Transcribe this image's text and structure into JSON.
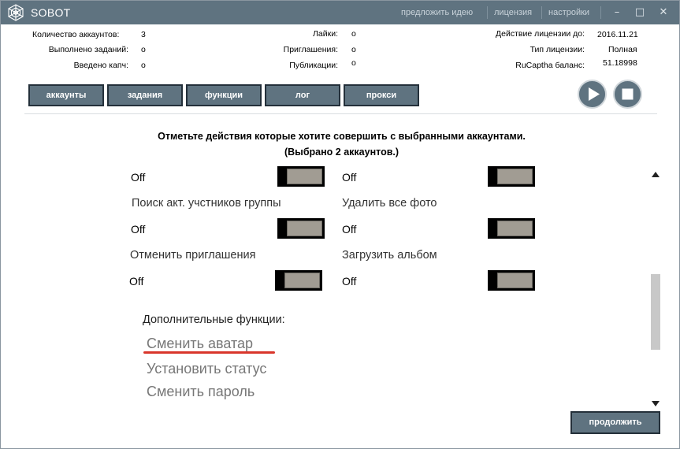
{
  "titlebar": {
    "app_title": "SOBOT",
    "links": [
      "предложить идею",
      "лицензия",
      "настройки"
    ],
    "minimize": "–",
    "maximize": "□",
    "close": "✕"
  },
  "stats": {
    "accounts_label": "Количество аккаунтов:",
    "accounts_value": "3",
    "tasks_done_label": "Выполнено заданий:",
    "tasks_done_value": "o",
    "captcha_label": "Введено капч:",
    "captcha_value": "o",
    "likes_label": "Лайки:",
    "likes_value": "o",
    "invites_label": "Приглашения:",
    "invites_value": "o",
    "posts_label": "Публикации:",
    "posts_value": "o",
    "license_until_label": "Действие лицензии до:",
    "license_until_value": "2016.11.21",
    "license_type_label": "Тип лицензии:",
    "license_type_value": "Полная",
    "rucaptcha_label": "RuCaptha баланс:",
    "rucaptcha_value": "51.18998"
  },
  "tabs": [
    "аккаунты",
    "задания",
    "функции",
    "лог",
    "прокси"
  ],
  "heading": {
    "line1": "Отметьте действия которые хотите совершить с выбранными аккаунтами.",
    "line2": "(Выбрано 2 аккаунтов.)"
  },
  "toggles": {
    "off_label": "Off",
    "options": [
      "Поиск акт. учстников группы",
      "Удалить все фото",
      "Отменить приглашения",
      "Загрузить альбом"
    ],
    "states": [
      false,
      false,
      false,
      false,
      false,
      false
    ]
  },
  "extra": {
    "title": "Дополнительные функции:",
    "links": [
      "Сменить аватар",
      "Установить статус",
      "Сменить пароль"
    ]
  },
  "continue_label": "продолжить",
  "colors": {
    "titlebar": "#5f7380",
    "button": "#5f7380",
    "accent_underline": "#d9362b",
    "toggle_thumb": "#a19c93"
  }
}
